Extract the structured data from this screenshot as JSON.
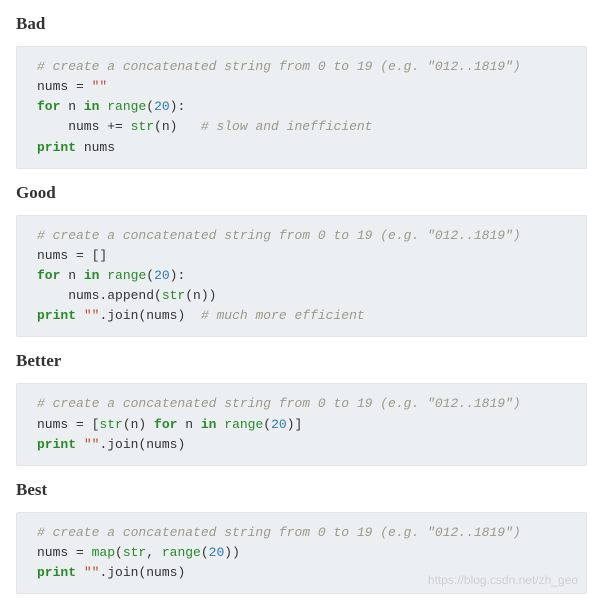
{
  "headings": {
    "bad": "Bad",
    "good": "Good",
    "better": "Better",
    "best": "Best"
  },
  "code": {
    "bad": {
      "l1_comment": "# create a concatenated string from 0 to 19 (e.g. \"012..1819\")",
      "l2_a": "nums = ",
      "l2_str": "\"\"",
      "l3_for": "for",
      "l3_b": " n ",
      "l3_in": "in",
      "l3_c": " ",
      "l3_range": "range",
      "l3_d": "(",
      "l3_num": "20",
      "l3_e": "):",
      "l4_a": "    nums += ",
      "l4_str": "str",
      "l4_b": "(n)   ",
      "l4_comment": "# slow and inefficient",
      "l5_print": "print",
      "l5_a": " nums"
    },
    "good": {
      "l1_comment": "# create a concatenated string from 0 to 19 (e.g. \"012..1819\")",
      "l2_a": "nums = []",
      "l3_for": "for",
      "l3_b": " n ",
      "l3_in": "in",
      "l3_c": " ",
      "l3_range": "range",
      "l3_d": "(",
      "l3_num": "20",
      "l3_e": "):",
      "l4_a": "    nums.append(",
      "l4_str": "str",
      "l4_b": "(n))",
      "l5_print": "print",
      "l5_a": " ",
      "l5_str": "\"\"",
      "l5_b": ".join(nums)  ",
      "l5_comment": "# much more efficient"
    },
    "better": {
      "l1_comment": "# create a concatenated string from 0 to 19 (e.g. \"012..1819\")",
      "l2_a": "nums = [",
      "l2_str": "str",
      "l2_b": "(n) ",
      "l2_for": "for",
      "l2_c": " n ",
      "l2_in": "in",
      "l2_d": " ",
      "l2_range": "range",
      "l2_e": "(",
      "l2_num": "20",
      "l2_f": ")]",
      "l3_print": "print",
      "l3_a": " ",
      "l3_str": "\"\"",
      "l3_b": ".join(nums)"
    },
    "best": {
      "l1_comment": "# create a concatenated string from 0 to 19 (e.g. \"012..1819\")",
      "l2_a": "nums = ",
      "l2_map": "map",
      "l2_b": "(",
      "l2_str": "str",
      "l2_c": ", ",
      "l2_range": "range",
      "l2_d": "(",
      "l2_num": "20",
      "l2_e": "))",
      "l3_print": "print",
      "l3_a": " ",
      "l3_str": "\"\"",
      "l3_b": ".join(nums)"
    }
  },
  "watermark": "https://blog.csdn.net/zh_geo"
}
